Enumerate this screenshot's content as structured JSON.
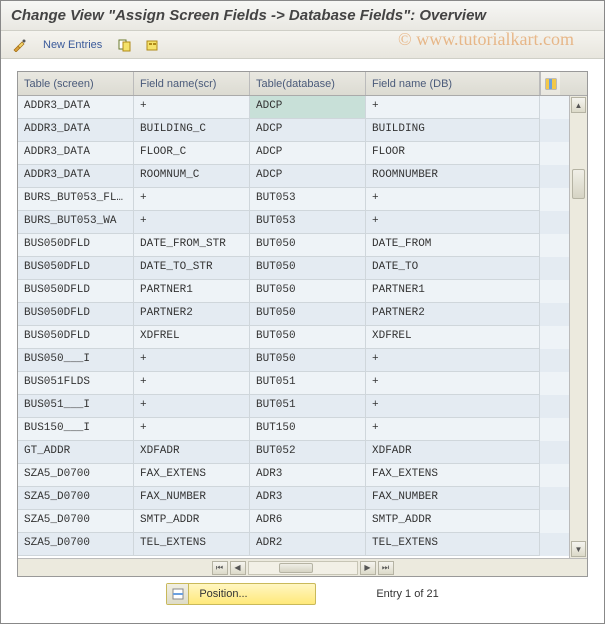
{
  "title": "Change View \"Assign Screen Fields -> Database Fields\": Overview",
  "watermark": "© www.tutorialkart.com",
  "toolbar": {
    "new_entries_label": "New Entries"
  },
  "columns": [
    "Table (screen)",
    "Field name(scr)",
    "Table(database)",
    "Field name (DB)"
  ],
  "rows": [
    {
      "c0": "ADDR3_DATA",
      "c1": "+",
      "c2": "ADCP",
      "c3": "+",
      "c2sel": true
    },
    {
      "c0": "ADDR3_DATA",
      "c1": "BUILDING_C",
      "c2": "ADCP",
      "c3": "BUILDING"
    },
    {
      "c0": "ADDR3_DATA",
      "c1": "FLOOR_C",
      "c2": "ADCP",
      "c3": "FLOOR"
    },
    {
      "c0": "ADDR3_DATA",
      "c1": "ROOMNUM_C",
      "c2": "ADCP",
      "c3": "ROOMNUMBER"
    },
    {
      "c0": "BURS_BUT053_FL…",
      "c1": "+",
      "c2": "BUT053",
      "c3": "+"
    },
    {
      "c0": "BURS_BUT053_WA",
      "c1": "+",
      "c2": "BUT053",
      "c3": "+"
    },
    {
      "c0": "BUS050DFLD",
      "c1": "DATE_FROM_STR",
      "c2": "BUT050",
      "c3": "DATE_FROM"
    },
    {
      "c0": "BUS050DFLD",
      "c1": "DATE_TO_STR",
      "c2": "BUT050",
      "c3": "DATE_TO"
    },
    {
      "c0": "BUS050DFLD",
      "c1": "PARTNER1",
      "c2": "BUT050",
      "c3": "PARTNER1"
    },
    {
      "c0": "BUS050DFLD",
      "c1": "PARTNER2",
      "c2": "BUT050",
      "c3": "PARTNER2"
    },
    {
      "c0": "BUS050DFLD",
      "c1": "XDFREL",
      "c2": "BUT050",
      "c3": "XDFREL"
    },
    {
      "c0": "BUS050___I",
      "c1": "+",
      "c2": "BUT050",
      "c3": "+"
    },
    {
      "c0": "BUS051FLDS",
      "c1": "+",
      "c2": "BUT051",
      "c3": "+"
    },
    {
      "c0": "BUS051___I",
      "c1": "+",
      "c2": "BUT051",
      "c3": "+"
    },
    {
      "c0": "BUS150___I",
      "c1": "+",
      "c2": "BUT150",
      "c3": "+"
    },
    {
      "c0": "GT_ADDR",
      "c1": "XDFADR",
      "c2": "BUT052",
      "c3": "XDFADR"
    },
    {
      "c0": "SZA5_D0700",
      "c1": "FAX_EXTENS",
      "c2": "ADR3",
      "c3": "FAX_EXTENS"
    },
    {
      "c0": "SZA5_D0700",
      "c1": "FAX_NUMBER",
      "c2": "ADR3",
      "c3": "FAX_NUMBER"
    },
    {
      "c0": "SZA5_D0700",
      "c1": "SMTP_ADDR",
      "c2": "ADR6",
      "c3": "SMTP_ADDR"
    },
    {
      "c0": "SZA5_D0700",
      "c1": "TEL_EXTENS",
      "c2": "ADR2",
      "c3": "TEL_EXTENS"
    }
  ],
  "footer": {
    "position_label": "Position...",
    "entry_text": "Entry 1 of 21"
  }
}
